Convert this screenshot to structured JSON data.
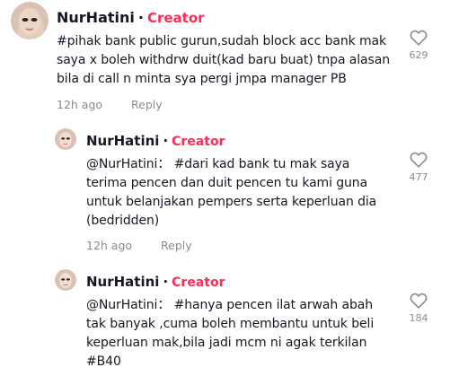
{
  "comments": [
    {
      "author": "NurHatini",
      "separator": "·",
      "badge": "Creator",
      "text": "#pihak bank public gurun,sudah block acc bank mak saya x boleh withdrw duit(kad baru buat) tnpa alasan bila di call n minta sya pergi jmpa manager PB",
      "time": "12h ago",
      "reply_label": "Reply",
      "likes": "629"
    },
    {
      "author": "NurHatini",
      "separator": "·",
      "badge": "Creator",
      "text": "@NurHatini：  #dari kad bank tu mak saya terima pencen dan duit pencen tu kami guna untuk belanjakan pempers serta keperluan dia (bedridden)",
      "time": "12h ago",
      "reply_label": "Reply",
      "likes": "477"
    },
    {
      "author": "NurHatini",
      "separator": "·",
      "badge": "Creator",
      "text": "@NurHatini：  #hanya pencen ilat arwah abah tak banyak ,cuma boleh membantu untuk beli keperluan mak,bila jadi mcm ni agak terkilan #B40",
      "likes": "184"
    }
  ],
  "colors": {
    "creator_badge": "#fe2c55",
    "text_primary": "#161823",
    "text_secondary": "#8a8b91"
  },
  "icons": {
    "like": "heart-outline-icon"
  }
}
